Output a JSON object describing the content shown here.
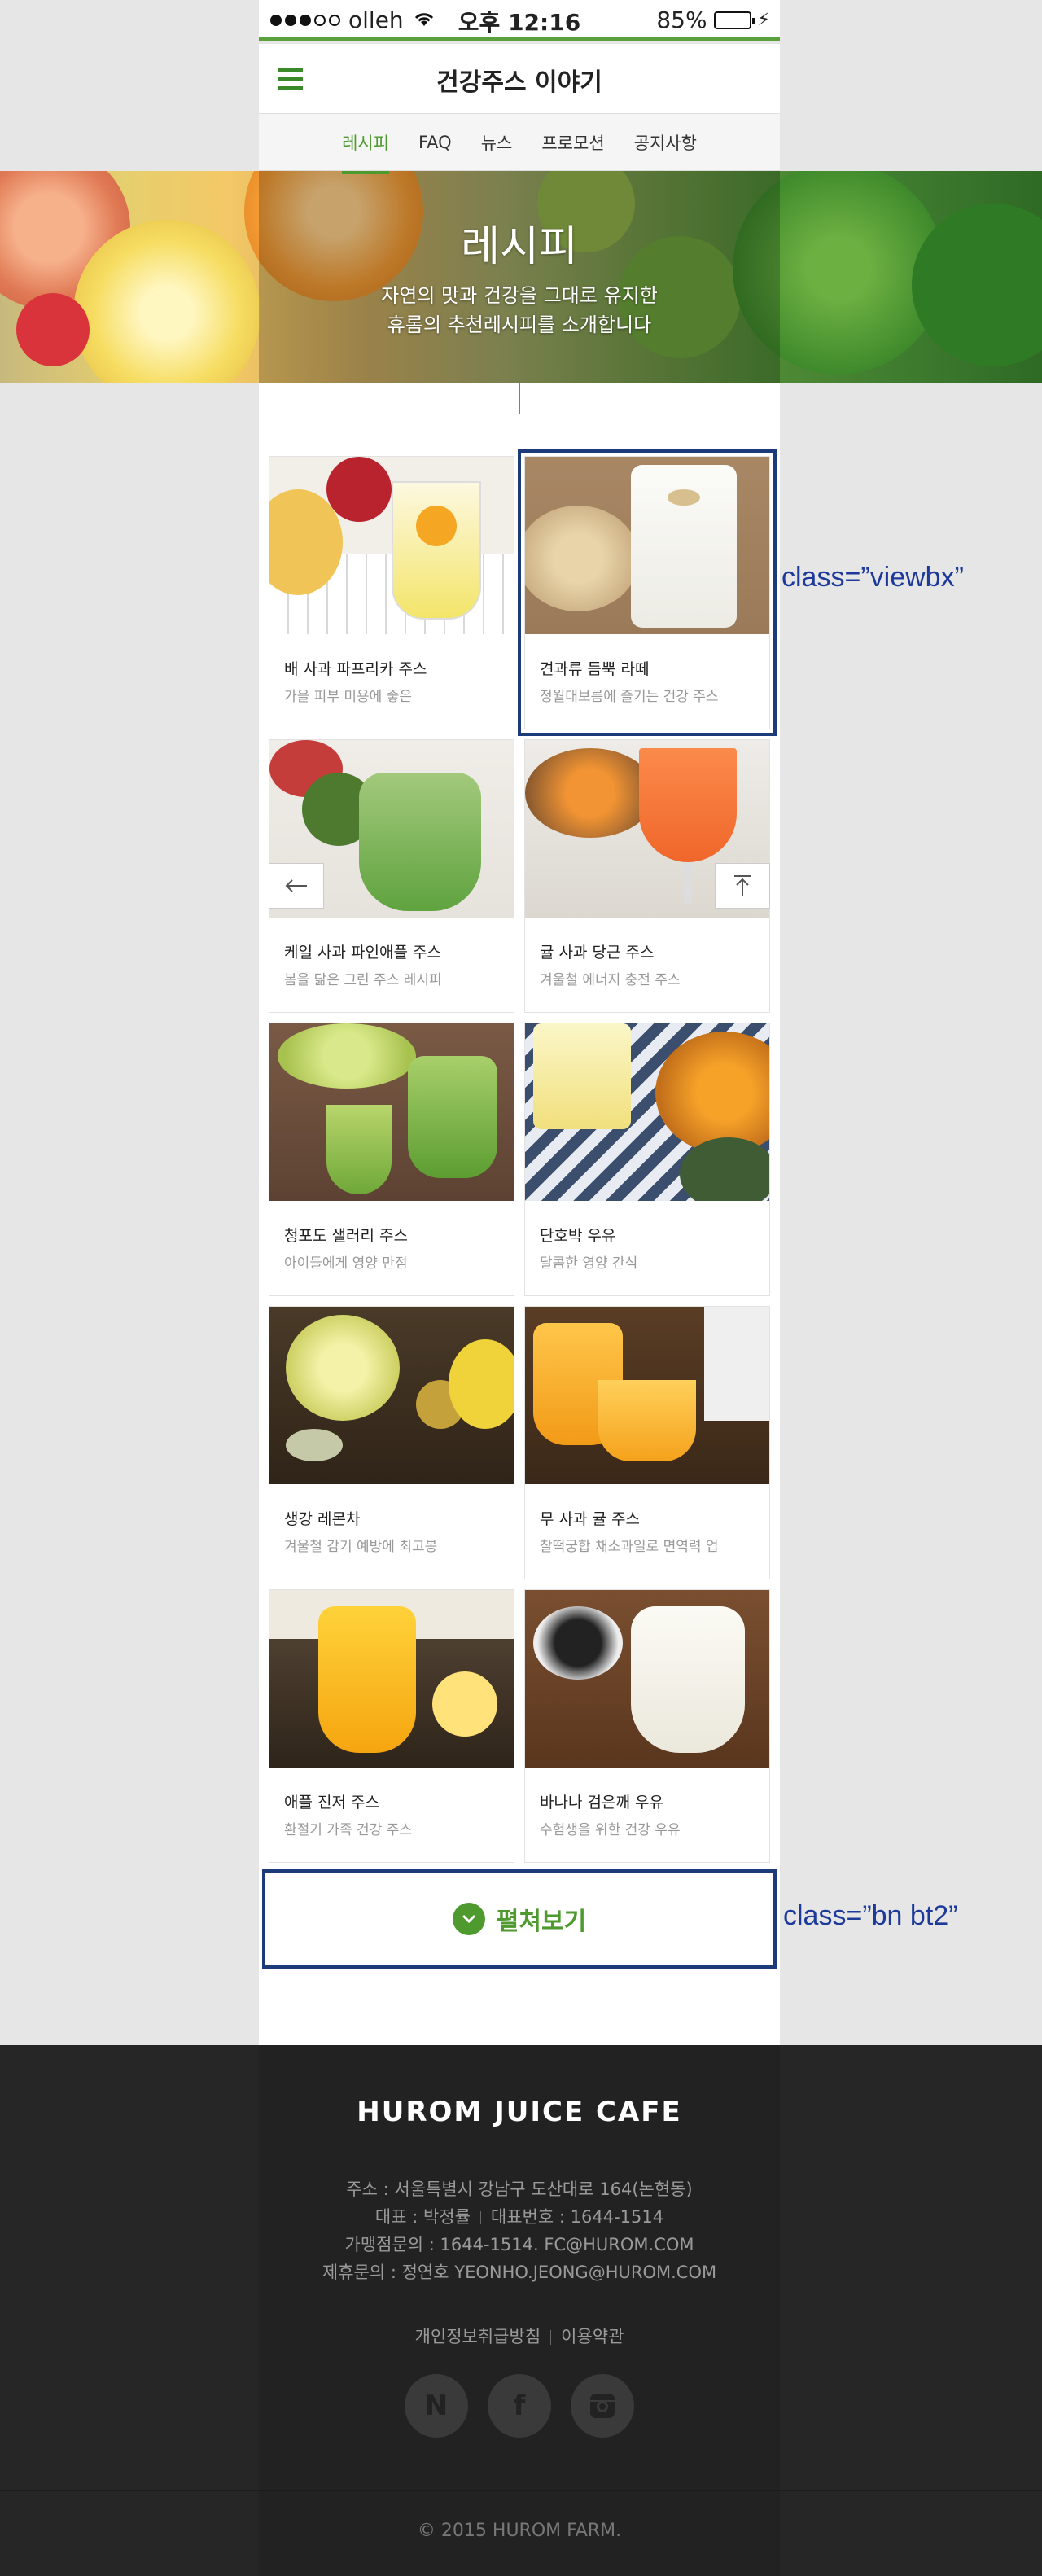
{
  "status": {
    "carrier": "olleh",
    "time": "오후 12:16",
    "battery": "85%",
    "battery_level": 0.85
  },
  "header": {
    "title": "건강주스 이야기"
  },
  "tabs": [
    {
      "label": "레시피",
      "active": true
    },
    {
      "label": "FAQ",
      "active": false
    },
    {
      "label": "뉴스",
      "active": false
    },
    {
      "label": "프로모션",
      "active": false
    },
    {
      "label": "공지사항",
      "active": false
    }
  ],
  "hero": {
    "title": "레시피",
    "line1": "자연의 맛과 건강을 그대로 유지한",
    "line2": "휴롬의 추천레시피를 소개합니다"
  },
  "recipes": [
    {
      "name": "배 사과 파프리카 주스",
      "desc": "가을 피부 미용에 좋은"
    },
    {
      "name": "견과류 듬뿍 라떼",
      "desc": "정월대보름에 즐기는 건강 주스"
    },
    {
      "name": "케일 사과 파인애플 주스",
      "desc": "봄을 닮은 그린 주스 레시피"
    },
    {
      "name": "귤 사과 당근 주스",
      "desc": "겨울철 에너지 충전 주스"
    },
    {
      "name": "청포도 샐러리 주스",
      "desc": "아이들에게 영양 만점"
    },
    {
      "name": "단호박 우유",
      "desc": "달콤한 영양 간식"
    },
    {
      "name": "생강 레몬차",
      "desc": "겨울철 감기 예방에 최고봉"
    },
    {
      "name": "무 사과 귤 주스",
      "desc": "찰떡궁합 채소과일로 면역력 업"
    },
    {
      "name": "애플 진저 주스",
      "desc": "환절기 가족 건강 주스"
    },
    {
      "name": "바나나 검은깨 우유",
      "desc": "수험생을 위한 건강 우유"
    }
  ],
  "more_button": {
    "label": "펼쳐보기"
  },
  "annotations": {
    "viewbx": "class=”viewbx”",
    "bn": "class=”bn bt2”"
  },
  "footer": {
    "logo": "HUROM JUICE CAFE",
    "address": "주소 : 서울특별시 강남구 도산대로 164(논현동)",
    "ceo": "대표 : 박정률",
    "phone": "대표번호 : 1644-1514",
    "franchise": "가맹점문의 : 1644-1514. FC@HUROM.COM",
    "partner": "제휴문의 : 정연호 YEONHO.JEONG@HUROM.COM",
    "privacy": "개인정보취급방침",
    "terms": "이용약관",
    "copyright": "© 2015 HUROM FARM."
  },
  "colors": {
    "accent": "#4e9a2e",
    "annotation": "#1d3a9a",
    "footer_bg": "#222222"
  }
}
